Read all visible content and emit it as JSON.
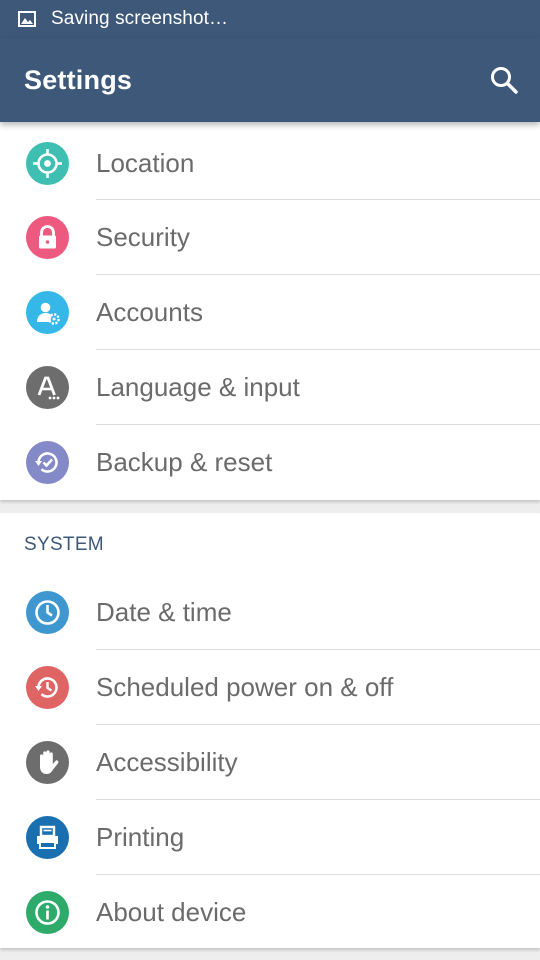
{
  "status_bar": {
    "notification_text": "Saving screenshot…",
    "notification_icon": "image-icon"
  },
  "toolbar": {
    "title": "Settings",
    "search_icon": "search-icon"
  },
  "colors": {
    "primary": "#3d5878",
    "background": "#eeeeee",
    "label_text": "#6b6b6b",
    "section_header": "#3d5878"
  },
  "personal_items": [
    {
      "label": "Location",
      "icon": "location-target-icon",
      "color": "#3fbfb2"
    },
    {
      "label": "Security",
      "icon": "lock-icon",
      "color": "#ee5a7f"
    },
    {
      "label": "Accounts",
      "icon": "account-settings-icon",
      "color": "#35b8e8"
    },
    {
      "label": "Language & input",
      "icon": "language-icon",
      "color": "#6d6d6d"
    },
    {
      "label": "Backup & reset",
      "icon": "backup-restore-icon",
      "color": "#8489c7"
    }
  ],
  "system_section": {
    "header": "SYSTEM",
    "items": [
      {
        "label": "Date & time",
        "icon": "clock-icon",
        "color": "#3f97cf"
      },
      {
        "label": "Scheduled power on & off",
        "icon": "power-schedule-icon",
        "color": "#df6565"
      },
      {
        "label": "Accessibility",
        "icon": "hand-icon",
        "color": "#6d6d6d"
      },
      {
        "label": "Printing",
        "icon": "printer-icon",
        "color": "#1a6fb0"
      },
      {
        "label": "About device",
        "icon": "info-icon",
        "color": "#2eaa6a"
      }
    ]
  }
}
